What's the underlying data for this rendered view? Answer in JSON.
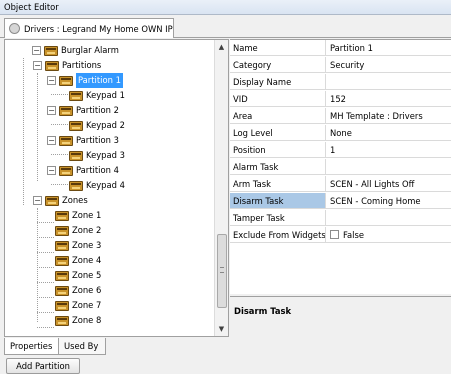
{
  "window": {
    "title": "Object Editor"
  },
  "tab": {
    "label": "Drivers : Legrand My Home OWN IP"
  },
  "tree": [
    {
      "label": "Burglar Alarm",
      "expander": "−"
    },
    {
      "label": "Partitions",
      "expander": "−"
    },
    {
      "label": "Partition 1",
      "expander": "−",
      "selected": true
    },
    {
      "label": "Keypad 1"
    },
    {
      "label": "Partition 2",
      "expander": "−"
    },
    {
      "label": "Keypad 2"
    },
    {
      "label": "Partition 3",
      "expander": "−"
    },
    {
      "label": "Keypad 3"
    },
    {
      "label": "Partition 4",
      "expander": "−"
    },
    {
      "label": "Keypad 4"
    },
    {
      "label": "Zones",
      "expander": "−"
    },
    {
      "label": "Zone 1"
    },
    {
      "label": "Zone 2"
    },
    {
      "label": "Zone 3"
    },
    {
      "label": "Zone 4"
    },
    {
      "label": "Zone 5"
    },
    {
      "label": "Zone 6"
    },
    {
      "label": "Zone 7"
    },
    {
      "label": "Zone 8"
    }
  ],
  "properties": [
    {
      "name": "Name",
      "value": "Partition 1"
    },
    {
      "name": "Category",
      "value": "Security"
    },
    {
      "name": "Display Name",
      "value": ""
    },
    {
      "name": "VID",
      "value": "152"
    },
    {
      "name": "Area",
      "value": "MH Template : Drivers"
    },
    {
      "name": "Log Level",
      "value": "None"
    },
    {
      "name": "Position",
      "value": "1"
    },
    {
      "name": "Alarm Task",
      "value": ""
    },
    {
      "name": "Arm Task",
      "value": "SCEN - All Lights Off"
    },
    {
      "name": "Disarm Task",
      "value": "SCEN - Coming Home",
      "selected": true
    },
    {
      "name": "Tamper Task",
      "value": ""
    },
    {
      "name": "Exclude From Widgets",
      "value": "False",
      "checkbox": true
    }
  ],
  "description": {
    "title": "Disarm Task"
  },
  "bottom_tabs": [
    "Properties",
    "Used By"
  ],
  "add_button": "Add Partition"
}
